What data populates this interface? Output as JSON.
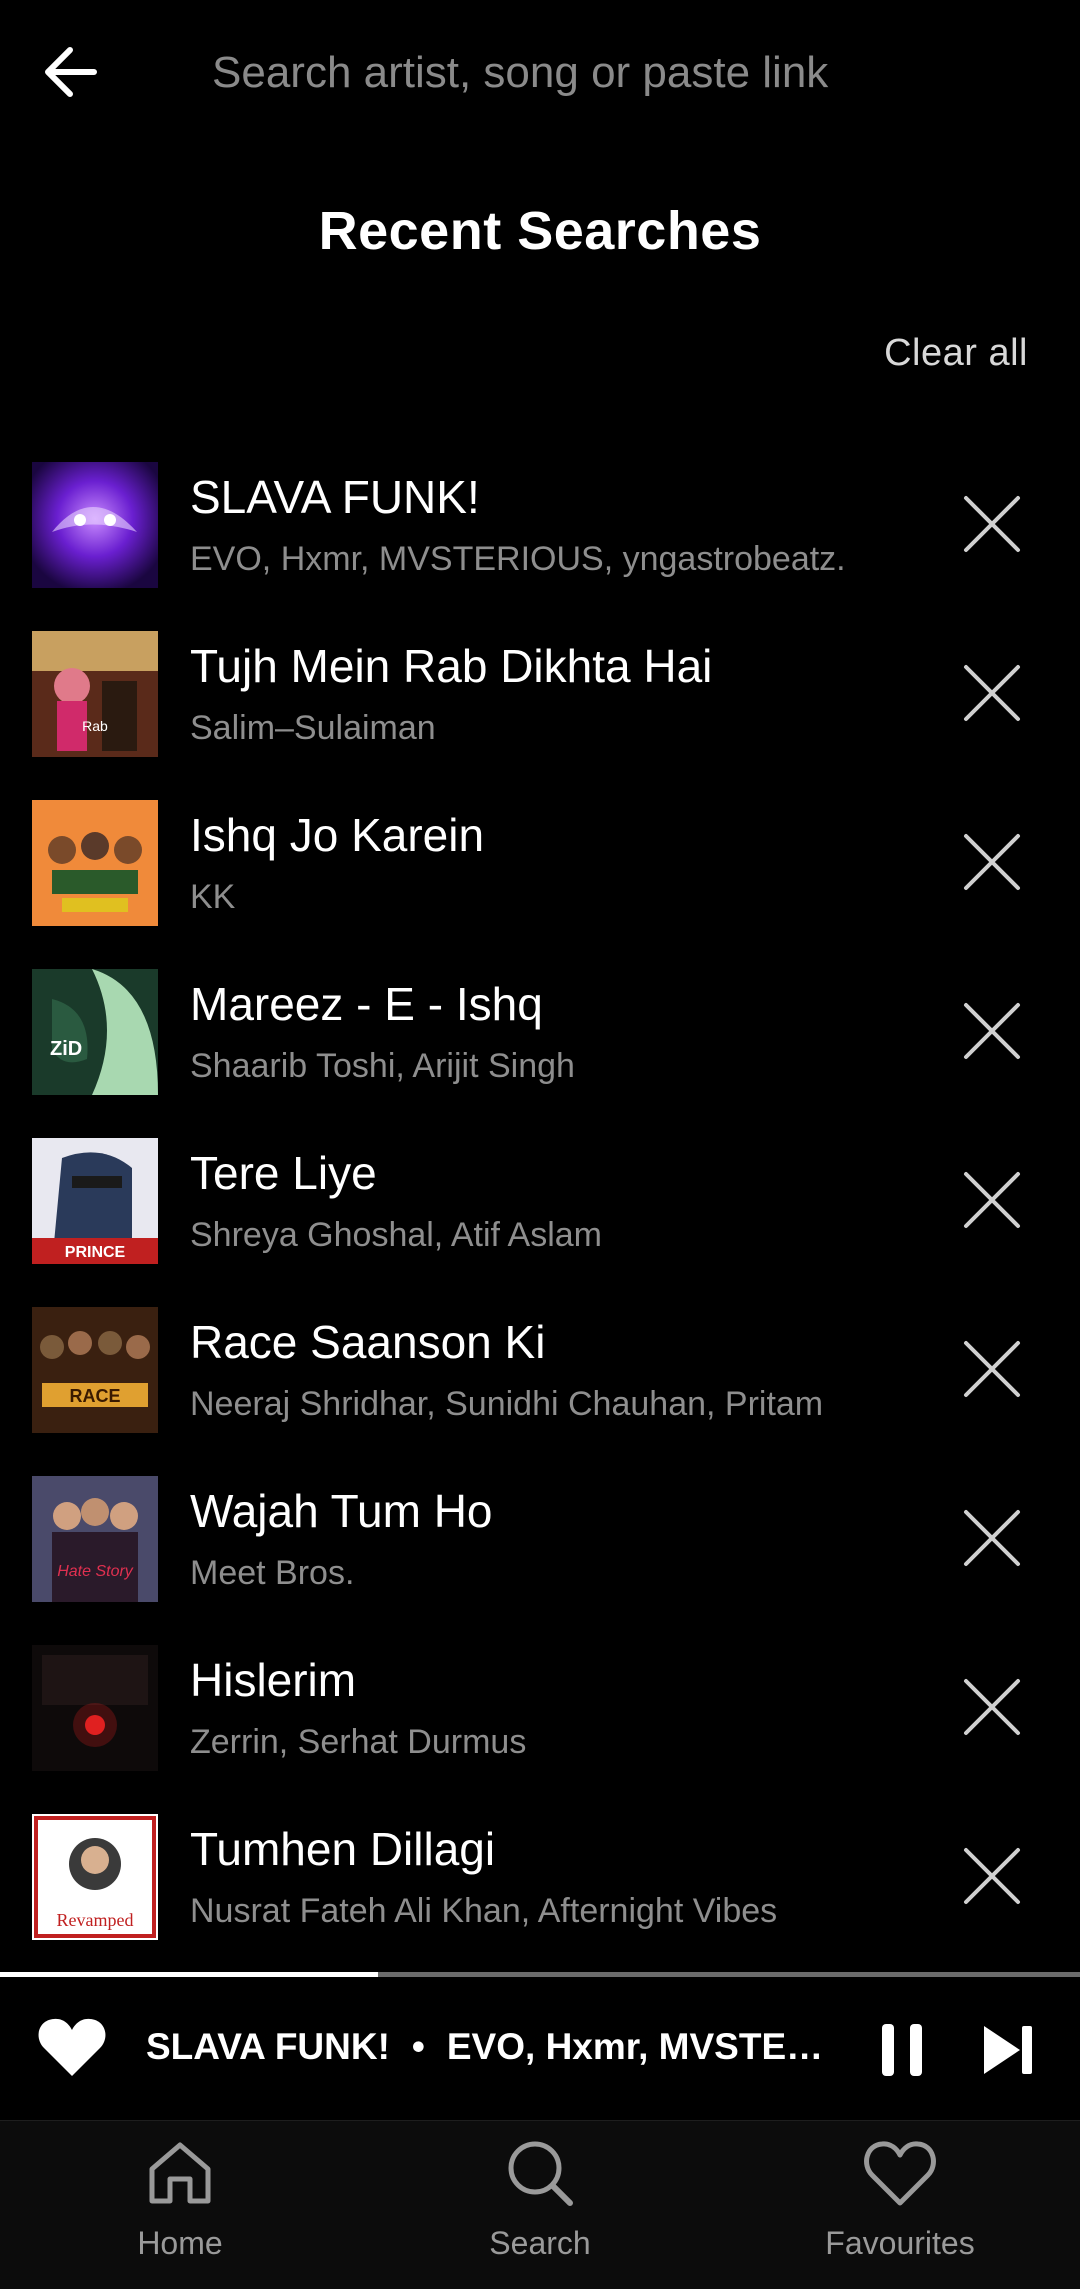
{
  "search": {
    "placeholder": "Search artist, song or paste link"
  },
  "recent": {
    "title": "Recent Searches",
    "clear_all_label": "Clear all",
    "items": [
      {
        "title": "SLAVA FUNK!",
        "artist": "EVO, Hxmr, MVSTERIOUS, yngastrobeatz."
      },
      {
        "title": "Tujh Mein Rab Dikhta Hai",
        "artist": "Salim–Sulaiman"
      },
      {
        "title": "Ishq Jo Karein",
        "artist": "KK"
      },
      {
        "title": "Mareez - E - Ishq",
        "artist": "Shaarib Toshi, Arijit Singh"
      },
      {
        "title": "Tere Liye",
        "artist": "Shreya Ghoshal, Atif Aslam"
      },
      {
        "title": "Race Saanson Ki",
        "artist": "Neeraj Shridhar, Sunidhi Chauhan, Pritam"
      },
      {
        "title": "Wajah Tum Ho",
        "artist": "Meet Bros."
      },
      {
        "title": "Hislerim",
        "artist": "Zerrin, Serhat Durmus"
      },
      {
        "title": "Tumhen Dillagi",
        "artist": "Nusrat Fateh Ali Khan, Afternight Vibes"
      }
    ]
  },
  "player": {
    "title": "SLAVA FUNK!",
    "separator": "•",
    "artist": "EVO, Hxmr, MVSTERI...",
    "progress": 0.35
  },
  "nav": {
    "home_label": "Home",
    "search_label": "Search",
    "favourites_label": "Favourites"
  },
  "colors": {
    "background": "#000000",
    "text_primary": "#ffffff",
    "text_secondary": "#8e8e8e"
  }
}
